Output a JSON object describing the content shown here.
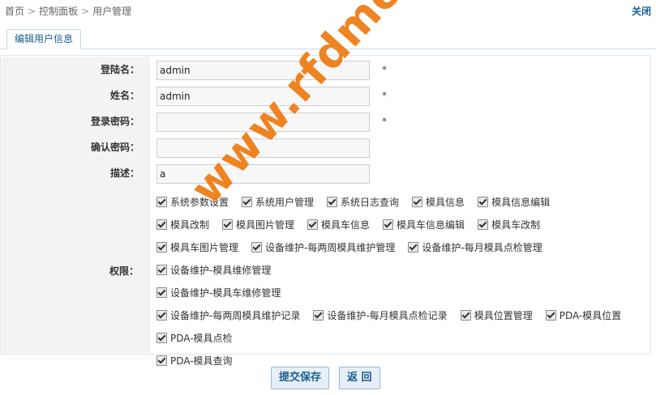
{
  "breadcrumb": [
    "首页",
    "控制面板",
    "用户管理"
  ],
  "breadcrumb_sep": ">",
  "close_label": "关闭",
  "tab_label": "编辑用户信息",
  "form": {
    "username_label": "登陆名：",
    "username_value": "admin",
    "name_label": "姓名：",
    "name_value": "admin",
    "password_label": "登录密码：",
    "password_value": "",
    "confirm_label": "确认密码：",
    "confirm_value": "",
    "desc_label": "描述：",
    "desc_value": "a",
    "required_mark": "*"
  },
  "permissions_label": "权限：",
  "permissions": [
    {
      "label": "系统参数设置",
      "checked": true
    },
    {
      "label": "系统用户管理",
      "checked": true
    },
    {
      "label": "系统日志查询",
      "checked": true
    },
    {
      "label": "模具信息",
      "checked": true
    },
    {
      "label": "模具信息编辑",
      "checked": true
    },
    {
      "label": "模具改制",
      "checked": true
    },
    {
      "label": "模具图片管理",
      "checked": true
    },
    {
      "label": "模具车信息",
      "checked": true
    },
    {
      "label": "模具车信息编辑",
      "checked": true
    },
    {
      "label": "模具车改制",
      "checked": true
    },
    {
      "label": "模具车图片管理",
      "checked": true
    },
    {
      "label": "设备维护-每两周模具维护管理",
      "checked": true
    },
    {
      "label": "设备维护-每月模具点检管理",
      "checked": true
    },
    {
      "label": "设备维护-模具维修管理",
      "checked": true
    },
    {
      "label": "设备维护-模具车维修管理",
      "checked": true
    },
    {
      "label": "设备维护-每两周模具维护记录",
      "checked": true
    },
    {
      "label": "设备维护-每月模具点检记录",
      "checked": true
    },
    {
      "label": "模具位置管理",
      "checked": true
    },
    {
      "label": "PDA-模具位置",
      "checked": true
    },
    {
      "label": "PDA-模具点检",
      "checked": true
    },
    {
      "label": "PDA-模具查询",
      "checked": true
    }
  ],
  "buttons": {
    "submit": "提交保存",
    "back": "返 回"
  },
  "watermark": "www.rfdmes.com",
  "colors": {
    "accent": "#1a5e8f",
    "watermark": "#ee7a11",
    "label_bg": "#f3f3f3"
  }
}
